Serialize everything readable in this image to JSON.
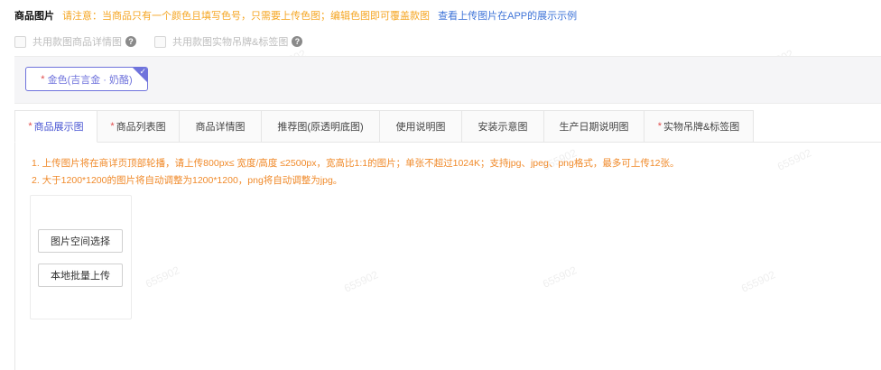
{
  "header": {
    "title": "商品图片",
    "note": "请注意：当商品只有一个颜色且填写色号，只需要上传色图；编辑色图即可覆盖款图",
    "link": "查看上传图片在APP的展示示例"
  },
  "options": [
    {
      "label": "共用款图商品详情图"
    },
    {
      "label": "共用款图实物吊牌&标签图"
    }
  ],
  "color_strip": {
    "chip_label": "金色(吉言金 · 奶酪)",
    "required_mark": "*"
  },
  "tabs": [
    {
      "label": "商品展示图",
      "required": true,
      "active": true
    },
    {
      "label": "商品列表图",
      "required": true,
      "active": false
    },
    {
      "label": "商品详情图",
      "required": false,
      "active": false
    },
    {
      "label": "推荐图(原透明底图)",
      "required": false,
      "active": false
    },
    {
      "label": "使用说明图",
      "required": false,
      "active": false
    },
    {
      "label": "安装示意图",
      "required": false,
      "active": false
    },
    {
      "label": "生产日期说明图",
      "required": false,
      "active": false
    },
    {
      "label": "实物吊牌&标签图",
      "required": true,
      "active": false
    }
  ],
  "upload_notes": [
    "1. 上传图片将在商详页顶部轮播，请上传800px≤ 宽度/高度 ≤2500px，宽高比1:1的图片；单张不超过1024K；支持jpg、jpeg、png格式，最多可上传12张。",
    "2. 大于1200*1200的图片将自动调整为1200*1200，png将自动调整为jpg。"
  ],
  "upload": {
    "space_select_label": "图片空间选择",
    "local_upload_label": "本地批量上传"
  },
  "icons": {
    "help": "question-circle-icon",
    "chip_check": "check-icon"
  },
  "colors": {
    "accent": "#6f73dc",
    "required": "#e14b4b",
    "warning": "#f08a2a",
    "link": "#3f74d8"
  }
}
